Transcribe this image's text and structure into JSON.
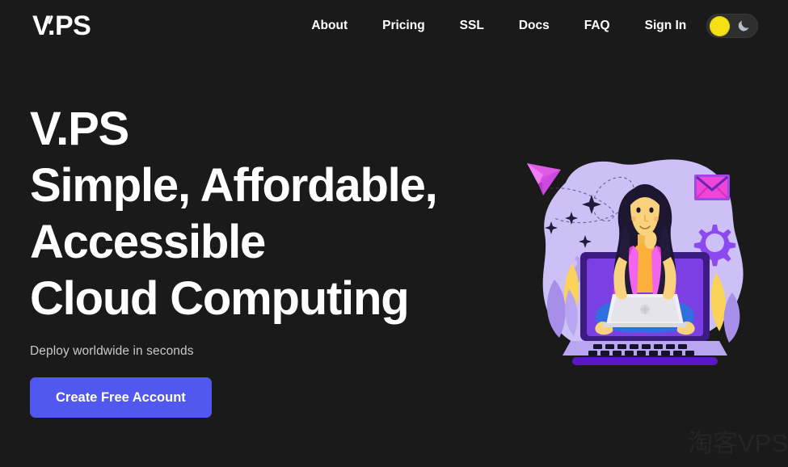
{
  "brand": {
    "logo_text": "V.PS",
    "logo_icon": "slash-accent"
  },
  "nav": {
    "items": [
      {
        "label": "About"
      },
      {
        "label": "Pricing"
      },
      {
        "label": "SSL"
      },
      {
        "label": "Docs"
      },
      {
        "label": "FAQ"
      },
      {
        "label": "Sign In"
      }
    ],
    "theme_toggle": {
      "state": "light",
      "sun_icon": "sun-icon",
      "moon_icon": "moon-icon",
      "sun_color": "#f5e014",
      "moon_color": "#b8bcc4",
      "track_color": "#2e2e2e"
    }
  },
  "hero": {
    "headline_lines": [
      "V.PS",
      "Simple, Affordable,",
      "Accessible",
      "Cloud Computing"
    ],
    "subtitle": "Deploy worldwide in seconds",
    "cta_label": "Create Free Account",
    "illustration_name": "woman-on-laptop-illustration"
  },
  "colors": {
    "background": "#1a1a1a",
    "text": "#ffffff",
    "muted_text": "#c9c9c9",
    "accent": "#5158f0",
    "blob": "#c9bdf5",
    "purple": "#7b3fe4",
    "magenta": "#e93ce0",
    "yellow": "#fbd35b",
    "blue": "#2f6fe0"
  },
  "watermark": {
    "text": "淘客VPS"
  }
}
